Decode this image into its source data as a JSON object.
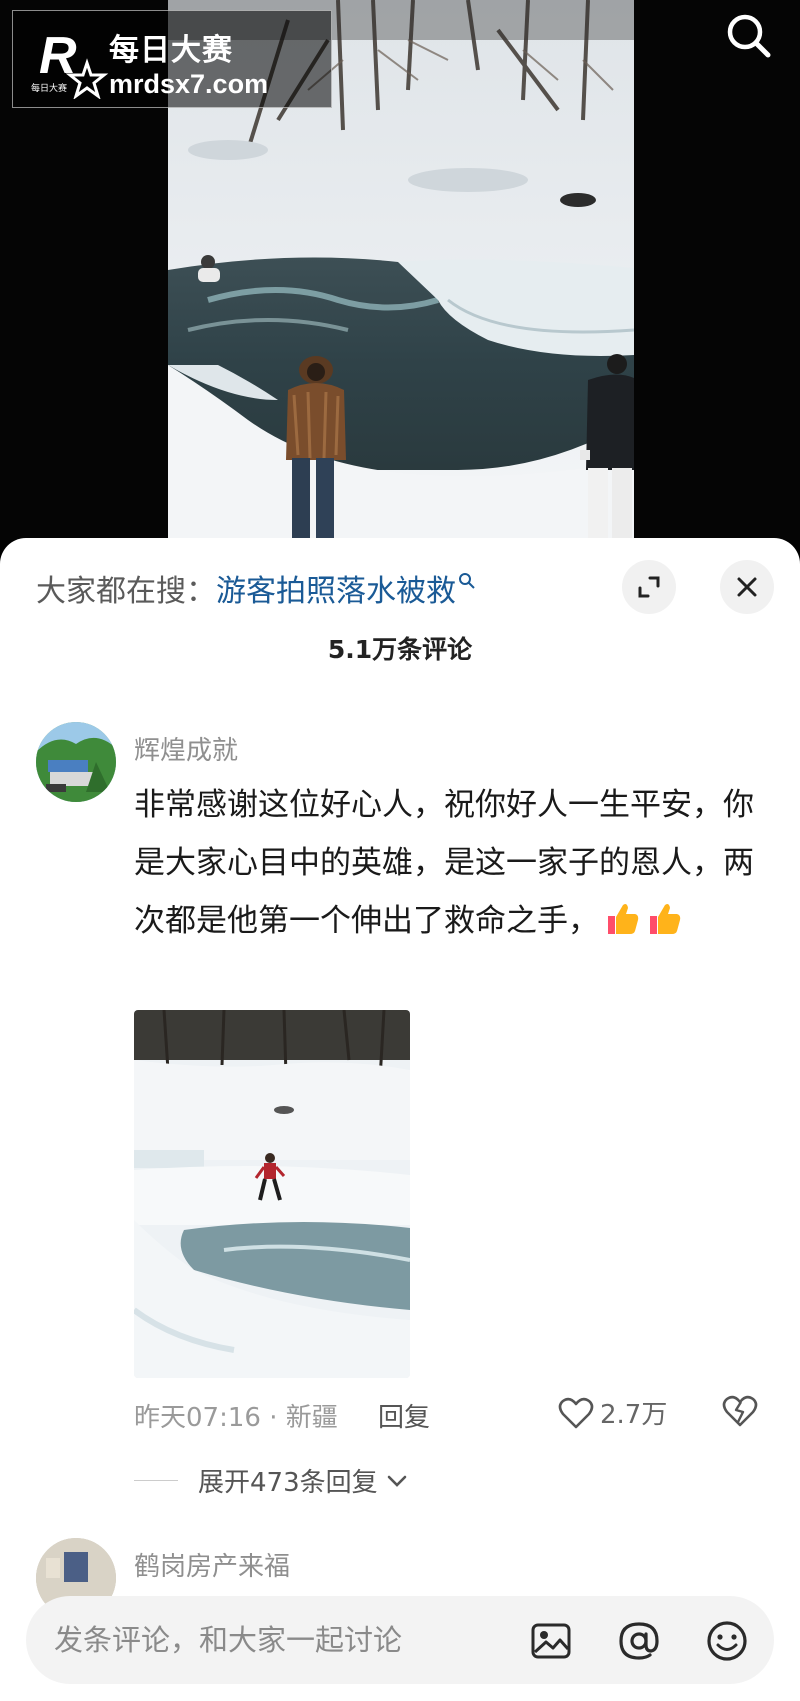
{
  "watermark": {
    "logo_letter": "R",
    "logo_small": "每日大赛",
    "title": "每日大赛",
    "url": "mrdsx7.com"
  },
  "hot_search": {
    "prefix": "大家都在搜：",
    "query": "游客拍照落水被救"
  },
  "comments_count": "5.1万条评论",
  "comments": [
    {
      "username": "辉煌成就",
      "text": "非常感谢这位好心人，祝你好人一生平安，你是大家心目中的英雄，是这一家子的恩人，两次都是他第一个伸出了救命之手，",
      "emojis": [
        "thumbs-up-icon",
        "thumbs-up-icon"
      ],
      "time": "昨天07:16",
      "location": "新疆",
      "meta_separator": " · ",
      "reply_label": "回复",
      "likes": "2.7万",
      "expand_replies": "展开473条回复"
    },
    {
      "username": "鹤岗房产来福"
    }
  ],
  "input": {
    "placeholder": "发条评论，和大家一起讨论"
  },
  "icons": [
    "search-icon",
    "expand-icon",
    "close-icon",
    "heart-icon",
    "dislike-heart-icon",
    "chevron-down-icon",
    "image-icon",
    "at-icon",
    "emoji-icon",
    "thumbs-up-icon"
  ],
  "colors": {
    "link": "#1a5a96",
    "sheet_bg": "#ffffff",
    "video_bg": "#050505",
    "input_bg": "#f3f3f3"
  }
}
